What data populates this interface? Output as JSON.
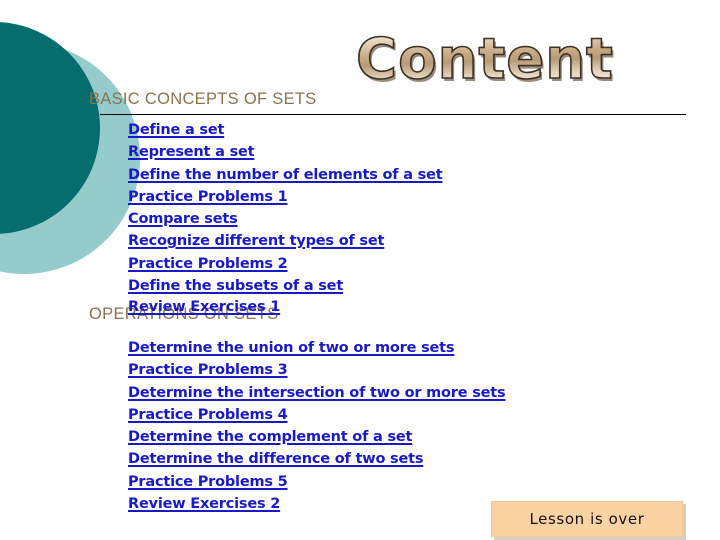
{
  "slide": {
    "title": "Content",
    "background_color": "#FFFFFF",
    "accent_dark_teal": "#056D6E",
    "accent_light_teal": "#96CBCC",
    "heading_color": "#8A7250",
    "link_color": "#1A1AC4",
    "button_color": "#FBD2A2"
  },
  "sections": [
    {
      "heading": "BASIC CONCEPTS OF SETS",
      "links": [
        "Define a set ",
        "Represent a set",
        "Define the number of elements of a set",
        "Practice Problems 1",
        "Compare sets",
        "Recognize different types of set",
        "Practice Problems 2",
        "Define the subsets of a set"
      ],
      "overlap_link": "Review Exercises 1"
    },
    {
      "heading": "OPERATIONS ON SETS",
      "links": [
        "Determine the union of two or more sets",
        "Practice Problems 3",
        "Determine the intersection of two or more sets",
        "Practice Problems 4",
        "Determine the complement of a set ",
        "Determine the difference of two sets",
        "Practice Problems 5",
        "Review Exercises 2"
      ]
    }
  ],
  "button": {
    "label": "Lesson is over"
  }
}
